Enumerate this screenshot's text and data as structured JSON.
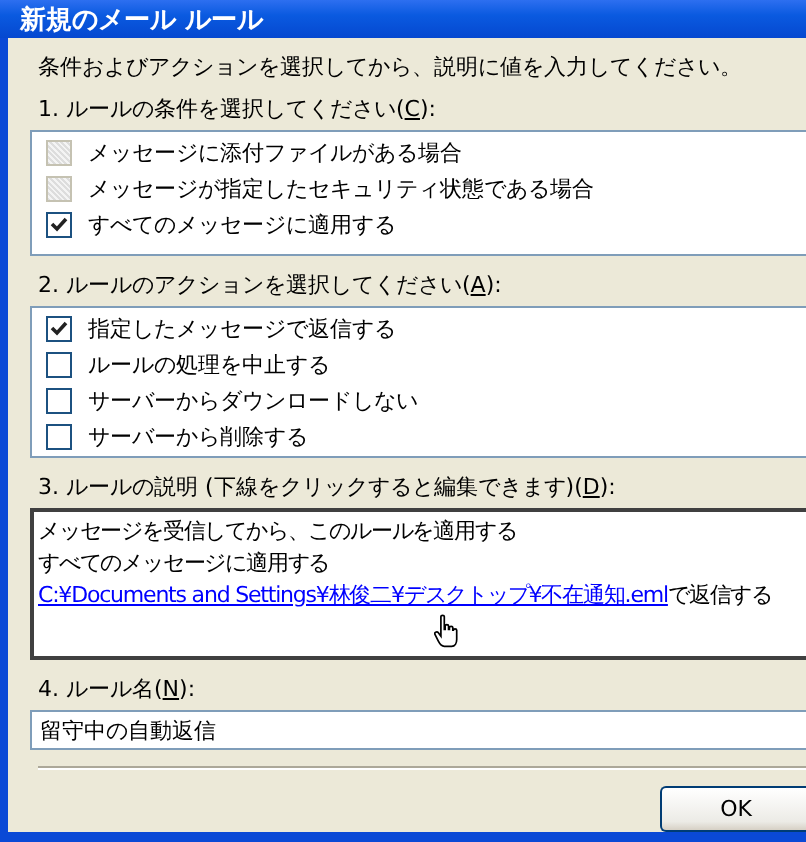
{
  "window": {
    "title": "新規のメール ルール"
  },
  "intro": "条件およびアクションを選択してから、説明に値を入力してください。",
  "conditions": {
    "label": {
      "text": "1. ルールの条件を選択してください(",
      "key": "C",
      "after": "):"
    },
    "items": [
      {
        "label": "メッセージに添付ファイルがある場合",
        "checked": false,
        "disabled": true
      },
      {
        "label": "メッセージが指定したセキュリティ状態である場合",
        "checked": false,
        "disabled": true
      },
      {
        "label": "すべてのメッセージに適用する",
        "checked": true,
        "disabled": false
      }
    ]
  },
  "actions": {
    "label": {
      "text": "2. ルールのアクションを選択してください(",
      "key": "A",
      "after": "):"
    },
    "items": [
      {
        "label": "指定したメッセージで返信する",
        "checked": true,
        "disabled": false
      },
      {
        "label": "ルールの処理を中止する",
        "checked": false,
        "disabled": false
      },
      {
        "label": "サーバーからダウンロードしない",
        "checked": false,
        "disabled": false
      },
      {
        "label": "サーバーから削除する",
        "checked": false,
        "disabled": false
      }
    ]
  },
  "description": {
    "label": {
      "text": "3. ルールの説明 (下線をクリックすると編集できます)(",
      "key": "D",
      "after": "):"
    },
    "lines": [
      {
        "text": "メッセージを受信してから、このルールを適用する"
      },
      {
        "text": "すべてのメッセージに適用する"
      },
      {
        "link": "C:¥Documents and Settings¥林俊二¥デスクトップ¥不在通知.eml",
        "text": "で返信する"
      }
    ]
  },
  "rule_name": {
    "label": {
      "text": "4. ルール名(",
      "key": "N",
      "after": "):"
    },
    "value": "留守中の自動返信"
  },
  "buttons": [
    "OK"
  ]
}
